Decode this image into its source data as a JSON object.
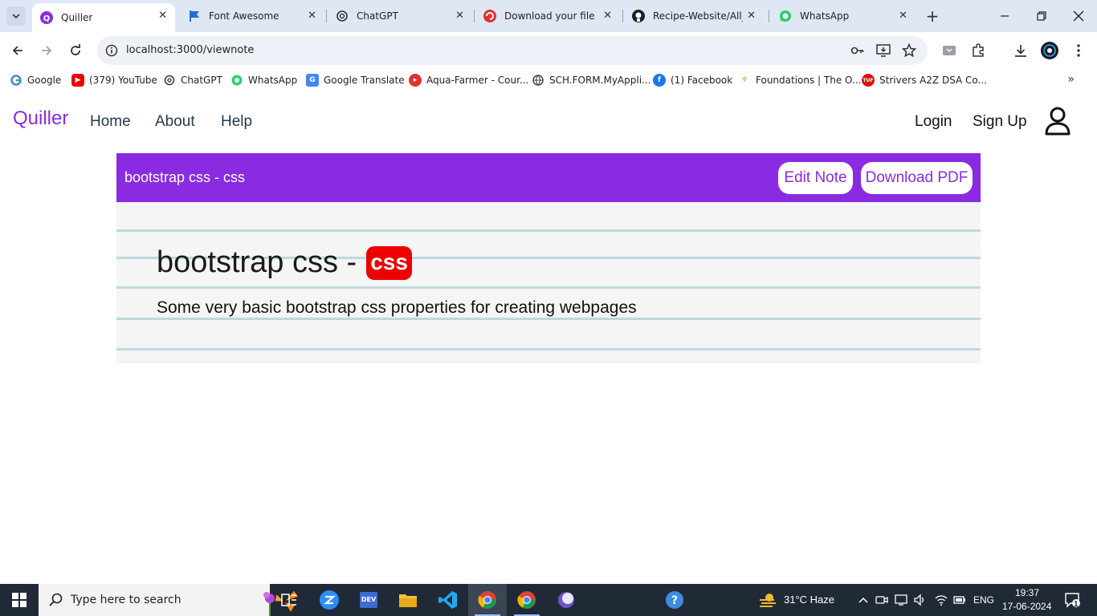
{
  "browser": {
    "tabs": [
      {
        "title": "Quiller",
        "icon": "quiller-favicon",
        "active": true
      },
      {
        "title": "Font Awesome",
        "icon": "font-awesome-favicon"
      },
      {
        "title": "ChatGPT",
        "icon": "chatgpt-favicon"
      },
      {
        "title": "Download your file –",
        "icon": "download-favicon"
      },
      {
        "title": "Recipe-Website/All_f",
        "icon": "github-favicon"
      },
      {
        "title": "WhatsApp",
        "icon": "whatsapp-favicon"
      }
    ],
    "url": "localhost:3000/viewnote",
    "bookmarks": [
      {
        "label": "Google",
        "icon": "google-favicon"
      },
      {
        "label": "(379) YouTube",
        "icon": "youtube-favicon"
      },
      {
        "label": "ChatGPT",
        "icon": "chatgpt-favicon"
      },
      {
        "label": "WhatsApp",
        "icon": "whatsapp-favicon"
      },
      {
        "label": "Google Translate",
        "icon": "translate-favicon"
      },
      {
        "label": "Aqua-Farmer - Cour...",
        "icon": "aqua-favicon"
      },
      {
        "label": "SCH.FORM.MyAppli...",
        "icon": "globe-favicon"
      },
      {
        "label": "(1) Facebook",
        "icon": "facebook-favicon"
      },
      {
        "label": "Foundations | The O...",
        "icon": "odin-favicon"
      },
      {
        "label": "Strivers A2Z DSA Co...",
        "icon": "tuf-favicon"
      }
    ]
  },
  "site": {
    "brand": "Quiller",
    "nav": {
      "home": "Home",
      "about": "About",
      "help": "Help"
    },
    "auth": {
      "login": "Login",
      "signup": "Sign Up"
    }
  },
  "note": {
    "header_title": "bootstrap css - css",
    "edit_label": "Edit Note",
    "download_label": "Download PDF",
    "title": "bootstrap css -",
    "tag": "css",
    "description": "Some very basic bootstrap css properties for creating webpages"
  },
  "taskbar": {
    "search_placeholder": "Type here to search",
    "weather": "31°C  Haze",
    "language": "ENG",
    "time": "19:37",
    "date": "17-06-2024",
    "notification_count": "1"
  },
  "colors": {
    "brand": "#8a2be2",
    "tag": "#ee0000",
    "note_body": "#f4f5f4",
    "rule": "#bcd9e0"
  }
}
